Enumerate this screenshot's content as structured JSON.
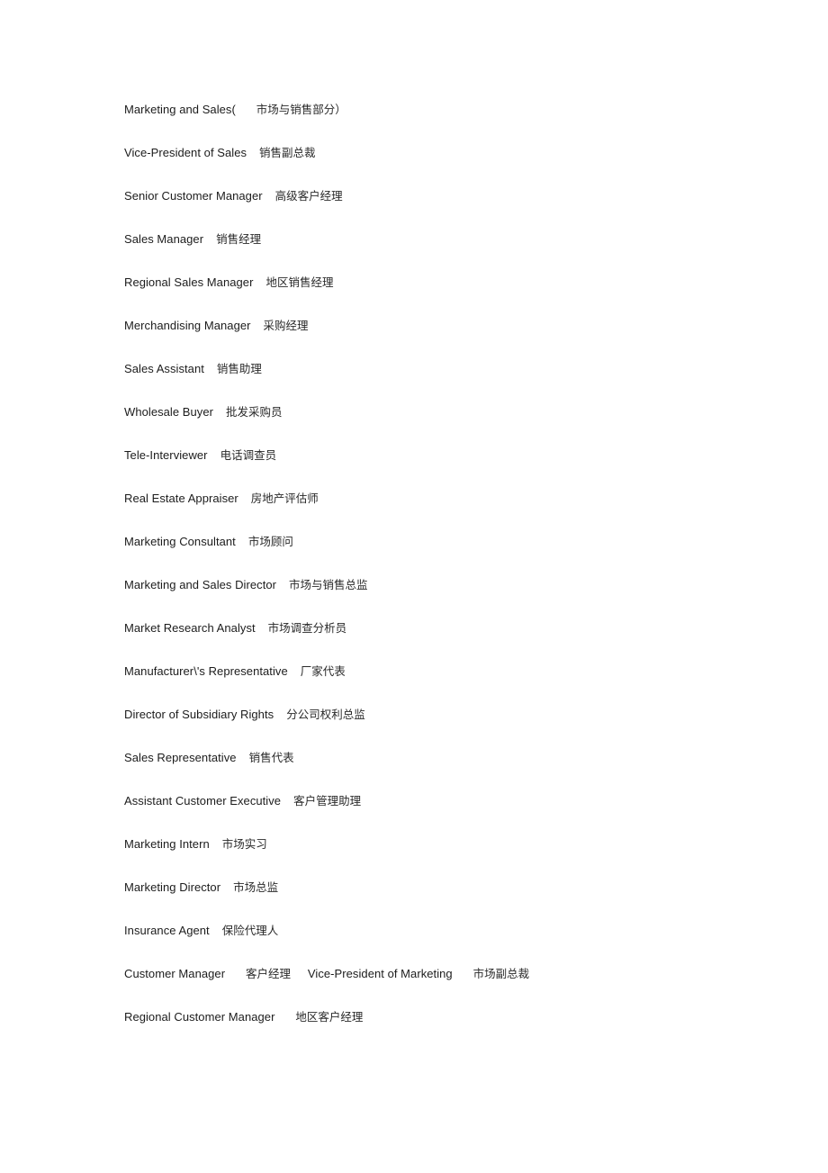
{
  "document": {
    "heading": {
      "en": "Marketing and Sales(",
      "cn": "市场与销售部分）"
    },
    "entries": [
      {
        "en": "Vice-President of Sales",
        "cn": "销售副总裁"
      },
      {
        "en": "Senior Customer Manager",
        "cn": "高级客户经理"
      },
      {
        "en": "Sales Manager",
        "cn": "销售经理"
      },
      {
        "en": "Regional Sales Manager",
        "cn": "地区销售经理"
      },
      {
        "en": "Merchandising Manager",
        "cn": "采购经理"
      },
      {
        "en": "Sales Assistant",
        "cn": "销售助理"
      },
      {
        "en": "Wholesale Buyer",
        "cn": "批发采购员"
      },
      {
        "en": "Tele-Interviewer",
        "cn": "电话调查员"
      },
      {
        "en": "Real Estate Appraiser",
        "cn": "房地产评估师"
      },
      {
        "en": "Marketing Consultant",
        "cn": "市场顾问"
      },
      {
        "en": "Marketing and Sales Director",
        "cn": "市场与销售总监"
      },
      {
        "en": "Market Research Analyst",
        "cn": "市场调查分析员"
      },
      {
        "en": "Manufacturer\\'s Representative",
        "cn": "厂家代表"
      },
      {
        "en": "Director of Subsidiary Rights",
        "cn": "分公司权利总监"
      },
      {
        "en": "Sales Representative",
        "cn": "销售代表"
      },
      {
        "en": "Assistant Customer Executive",
        "cn": "客户管理助理"
      },
      {
        "en": "Marketing Intern",
        "cn": "市场实习"
      },
      {
        "en": "Marketing Director",
        "cn": "市场总监"
      },
      {
        "en": "Insurance Agent",
        "cn": "保险代理人"
      }
    ],
    "paired_entry": {
      "first": {
        "en": "Customer Manager",
        "cn": "客户经理"
      },
      "second": {
        "en": "Vice-President of Marketing",
        "cn": "市场副总裁"
      }
    },
    "final_entry": {
      "en": "Regional Customer Manager",
      "cn": "地区客户经理"
    }
  }
}
